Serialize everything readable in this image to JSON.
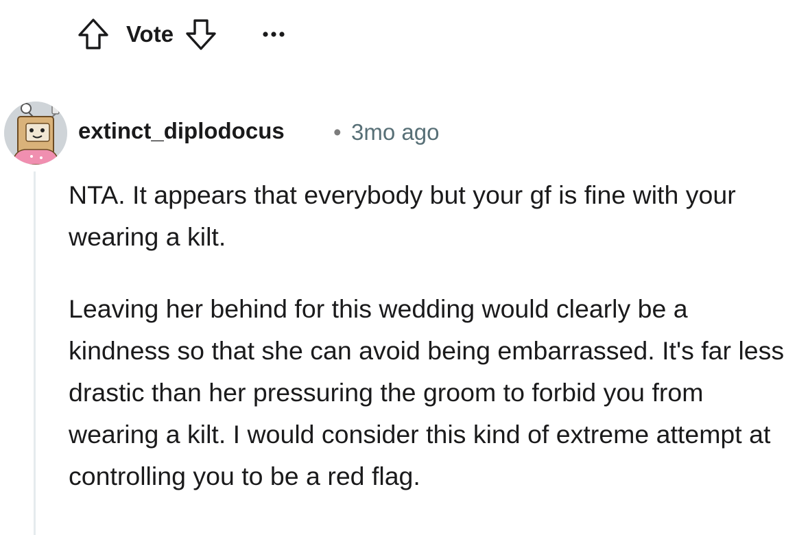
{
  "action_bar": {
    "vote_label": "Vote",
    "upvote_icon": "arrow-up-outline-icon",
    "downvote_icon": "arrow-down-outline-icon",
    "more_icon": "ellipsis-icon"
  },
  "comment": {
    "avatar_icon": "robot-avatar-icon",
    "username": "extinct_diplodocus",
    "separator": "•",
    "timestamp": "3mo ago",
    "paragraphs": [
      "NTA. It appears that everybody but your gf is fine with your wearing a kilt.",
      "Leaving her behind for this wedding would clearly be a kindness so that she can avoid being embarrassed. It's far less drastic than her pressuring the groom to forbid you from wearing a kilt. I would consider this kind of extreme attempt at controlling you to be a red flag."
    ]
  },
  "colors": {
    "text": "#1a1a1b",
    "meta": "#576f76",
    "thread_line": "#e5ebee"
  }
}
